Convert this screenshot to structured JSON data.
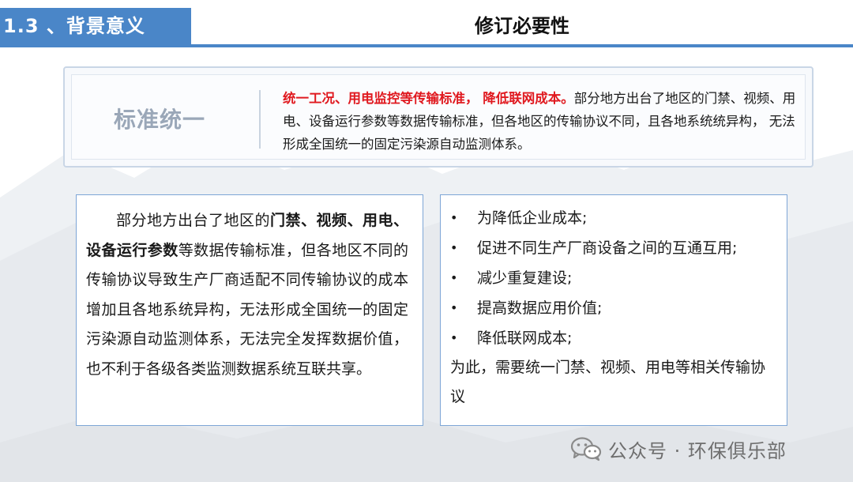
{
  "header": {
    "section": "1.3 、背景意义",
    "title": "修订必要性"
  },
  "banner": {
    "heading": "标准统一",
    "highlight": "统一工况、用电监控等传输标准， 降低联网成本。",
    "body": "部分地方出台了地区的门禁、视频、用电、设备运行参数等数据传输标准，但各地区的传输协议不同，且各地系统统异构， 无法形成全国统一的固定污染源自动监测体系。"
  },
  "left_box": {
    "intro": "部分地方出台了地区的",
    "bold": "门禁、视频、用电、设备运行参数",
    "rest": "等数据传输标准，但各地区不同的传输协议导致生产厂商适配不同传输协议的成本增加且各地系统异构，无法形成全国统一的固定污染源自动监测体系，无法完全发挥数据价值，也不利于各级各类监测数据系统互联共享。"
  },
  "right_box": {
    "bullet_symbol": "•",
    "items": [
      "为降低企业成本;",
      "促进不同生产厂商设备之间的互通互用;",
      "减少重复建设;",
      "提高数据应用价值;",
      "降低联网成本;"
    ],
    "conclusion": "为此，需要统一门禁、视频、用电等相关传输协议"
  },
  "watermark": {
    "text": "公众号 · 环保俱乐部",
    "icon": "wechat-icon"
  },
  "colors": {
    "accent": "#4a86c8",
    "highlight_red": "#e0191f",
    "box_border": "#7ea6d6"
  }
}
